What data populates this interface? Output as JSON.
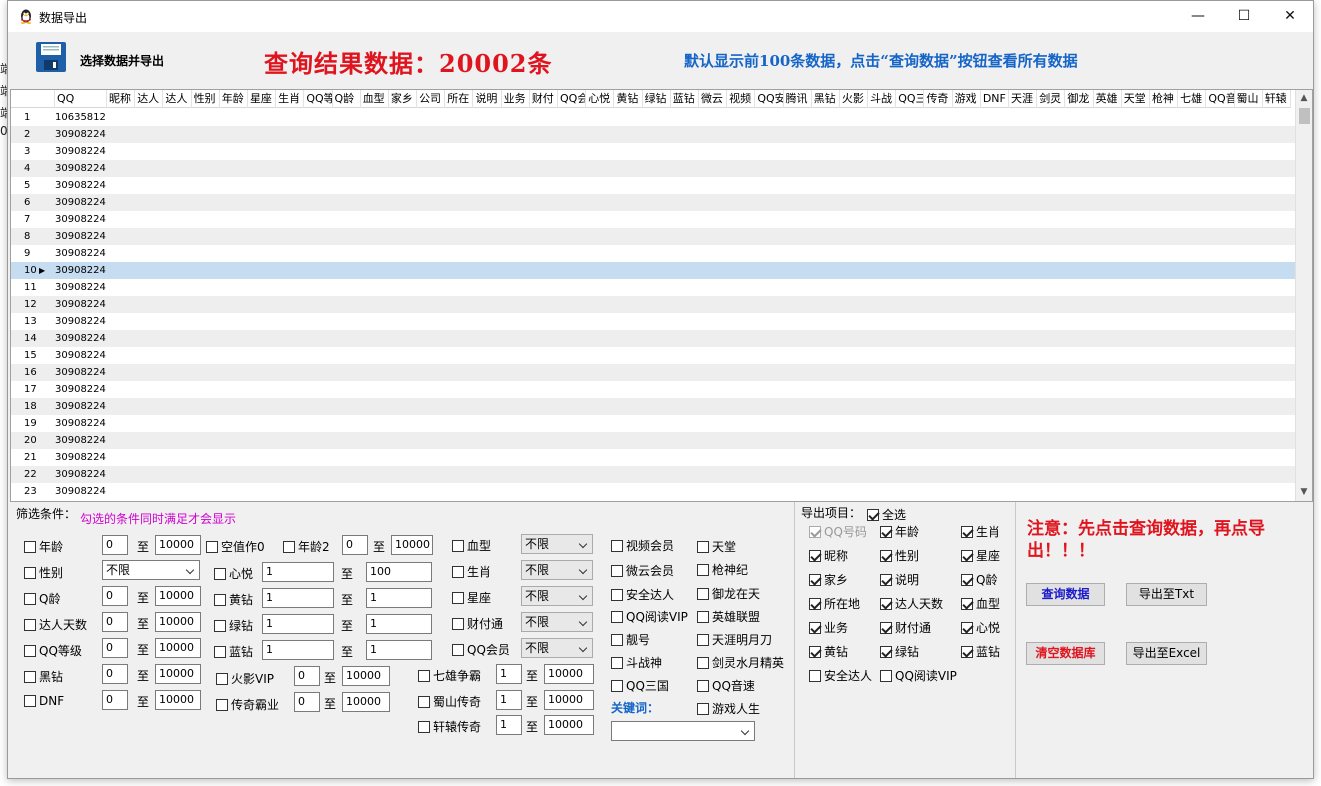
{
  "window": {
    "title": "数据导出",
    "minimize": "—",
    "maximize": "☐",
    "close": "✕"
  },
  "header": {
    "select_label": "选择数据并导出",
    "result_text": "查询结果数据：20002条",
    "hint_text": "默认显示前100条数据，点击“查询数据”按钮查看所有数据"
  },
  "grid": {
    "columns": [
      "QQ",
      "昵称",
      "达人",
      "达人",
      "性别",
      "年龄",
      "星座",
      "生肖",
      "QQ等",
      "Q龄",
      "血型",
      "家乡",
      "公司",
      "所在",
      "说明",
      "业务",
      "财付",
      "QQ会",
      "心悦",
      "黄钻",
      "绿钻",
      "蓝钻",
      "微云",
      "视频",
      "QQ安",
      "腾讯",
      "黑钻",
      "火影",
      "斗战",
      "QQ三",
      "传奇",
      "游戏",
      "DNF",
      "天涯",
      "剑灵",
      "御龙",
      "英雄",
      "天堂",
      "枪神",
      "七雄",
      "QQ音",
      "蜀山",
      "轩辕"
    ],
    "rows": [
      {
        "n": "1",
        "qq": "10635812"
      },
      {
        "n": "2",
        "qq": "30908224"
      },
      {
        "n": "3",
        "qq": "30908224"
      },
      {
        "n": "4",
        "qq": "30908224"
      },
      {
        "n": "5",
        "qq": "30908224"
      },
      {
        "n": "6",
        "qq": "30908224"
      },
      {
        "n": "7",
        "qq": "30908224"
      },
      {
        "n": "8",
        "qq": "30908224"
      },
      {
        "n": "9",
        "qq": "30908224"
      },
      {
        "n": "10",
        "qq": "30908224"
      },
      {
        "n": "11",
        "qq": "30908224"
      },
      {
        "n": "12",
        "qq": "30908224"
      },
      {
        "n": "13",
        "qq": "30908224"
      },
      {
        "n": "14",
        "qq": "30908224"
      },
      {
        "n": "15",
        "qq": "30908224"
      },
      {
        "n": "16",
        "qq": "30908224"
      },
      {
        "n": "17",
        "qq": "30908224"
      },
      {
        "n": "18",
        "qq": "30908224"
      },
      {
        "n": "19",
        "qq": "30908224"
      },
      {
        "n": "20",
        "qq": "30908224"
      },
      {
        "n": "21",
        "qq": "30908224"
      },
      {
        "n": "22",
        "qq": "30908224"
      },
      {
        "n": "23",
        "qq": "30908224"
      }
    ],
    "selected_row": "10"
  },
  "filter": {
    "title": "筛选条件：",
    "hint": "勾选的条件同时满足才会显示",
    "to": "至",
    "age": {
      "label": "年龄",
      "from": "0",
      "to": "10000"
    },
    "gender": {
      "label": "性别",
      "value": "不限"
    },
    "qage": {
      "label": "Q龄",
      "from": "0",
      "to": "10000"
    },
    "daren_days": {
      "label": "达人天数",
      "from": "0",
      "to": "10000"
    },
    "qq_level": {
      "label": "QQ等级",
      "from": "0",
      "to": "10000"
    },
    "black_diamond": {
      "label": "黑钻",
      "from": "0",
      "to": "10000"
    },
    "dnf": {
      "label": "DNF",
      "from": "0",
      "to": "10000"
    },
    "empty_value": {
      "label": "空值作0"
    },
    "age2": {
      "label": "年龄2",
      "from": "0",
      "to": "10000"
    },
    "xinyue": {
      "label": "心悦",
      "from": "1",
      "to": "100"
    },
    "yellow": {
      "label": "黄钻",
      "from": "1",
      "to": "1"
    },
    "green": {
      "label": "绿钻",
      "from": "1",
      "to": "1"
    },
    "blue": {
      "label": "蓝钻",
      "from": "1",
      "to": "1"
    },
    "huoying": {
      "label": "火影VIP",
      "from": "0",
      "to": "10000"
    },
    "chuanqi": {
      "label": "传奇霸业",
      "from": "0",
      "to": "10000"
    },
    "blood": {
      "label": "血型",
      "value": "不限"
    },
    "zodiac": {
      "label": "生肖",
      "value": "不限"
    },
    "star": {
      "label": "星座",
      "value": "不限"
    },
    "tenpay": {
      "label": "财付通",
      "value": "不限"
    },
    "qq_member": {
      "label": "QQ会员",
      "value": "不限"
    },
    "qixiong": {
      "label": "七雄争霸",
      "from": "1",
      "to": "10000"
    },
    "shushan": {
      "label": "蜀山传奇",
      "from": "1",
      "to": "10000"
    },
    "xuanyuan": {
      "label": "轩辕传奇",
      "from": "1",
      "to": "10000"
    },
    "col5": [
      "视频会员",
      "微云会员",
      "安全达人",
      "QQ阅读VIP",
      "靓号",
      "斗战神",
      "QQ三国"
    ],
    "col6": [
      "天堂",
      "枪神纪",
      "御龙在天",
      "英雄联盟",
      "天涯明月刀",
      "剑灵水月精英",
      "QQ音速",
      "游戏人生"
    ],
    "keyword_label": "关键词："
  },
  "export": {
    "title": "导出项目：",
    "select_all": "全选",
    "items": [
      [
        "QQ号码",
        "年龄",
        "生肖"
      ],
      [
        "昵称",
        "性别",
        "星座"
      ],
      [
        "家乡",
        "说明",
        "Q龄"
      ],
      [
        "所在地",
        "达人天数",
        "血型"
      ],
      [
        "业务",
        "财付通",
        "心悦"
      ],
      [
        "黄钻",
        "绿钻",
        "蓝钻"
      ],
      [
        "安全达人",
        "QQ阅读VIP",
        ""
      ]
    ]
  },
  "actions": {
    "note": "注意：先点击查询数据，再点导出！！！",
    "query": "查询数据",
    "export_txt": "导出至Txt",
    "clear_db": "清空数据库",
    "export_excel": "导出至Excel"
  },
  "colors": {
    "red": "#e0141e",
    "blue": "#1565c8",
    "selected_row": "#c6dcf1"
  }
}
